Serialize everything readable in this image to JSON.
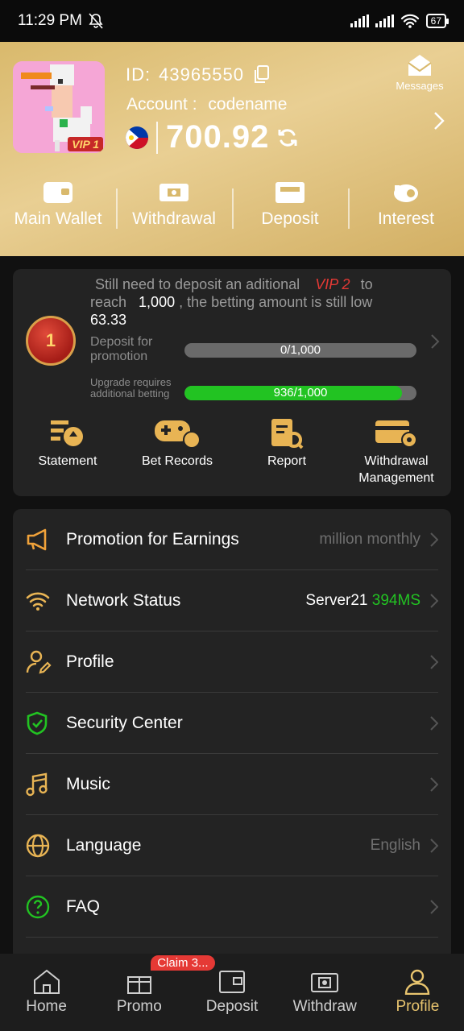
{
  "status_bar": {
    "time": "11:29 PM",
    "battery": "67"
  },
  "header": {
    "id_label": "ID:",
    "id_value": "43965550",
    "account_label": "Account :",
    "account_value": "codename",
    "vip_tag": "VIP 1",
    "balance": "700.92",
    "messages_label": "Messages",
    "wallet_items": [
      {
        "label": "Main Wallet",
        "icon": "wallet-icon"
      },
      {
        "label": "Withdrawal",
        "icon": "withdrawal-icon"
      },
      {
        "label": "Deposit",
        "icon": "deposit-icon"
      },
      {
        "label": "Interest",
        "icon": "piggy-bank-icon"
      }
    ]
  },
  "vip": {
    "line1_a": "Still need to deposit an aditional",
    "line1_vip": "VIP 2",
    "line1_b": "to",
    "line2_a": "reach",
    "line2_amount": "1,000",
    "line2_b": ", the betting amount is still low",
    "line3": "63.33",
    "badge_level": "1",
    "deposit_label": "Deposit for promotion",
    "deposit_bar_text": "0/1,000",
    "deposit_progress": 0,
    "betting_label": "Upgrade requires additional betting",
    "betting_bar_text": "936/1,000",
    "betting_progress": 0.936,
    "quick_items": [
      {
        "label": "Statement",
        "icon": "statement-icon"
      },
      {
        "label": "Bet Records",
        "icon": "gamepad-icon"
      },
      {
        "label": "Report",
        "icon": "report-icon"
      },
      {
        "label": "Withdrawal Management",
        "icon": "card-settings-icon"
      }
    ]
  },
  "menu": [
    {
      "label": "Promotion for Earnings",
      "value": "million monthly",
      "icon": "megaphone-icon"
    },
    {
      "label": "Network Status",
      "value": "Server21",
      "value_ms": "394MS",
      "icon": "wifi-icon"
    },
    {
      "label": "Profile",
      "value": "",
      "icon": "user-edit-icon"
    },
    {
      "label": "Security Center",
      "value": "",
      "icon": "shield-check-icon"
    },
    {
      "label": "Music",
      "value": "",
      "icon": "music-icon"
    },
    {
      "label": "Language",
      "value": "English",
      "icon": "globe-icon"
    },
    {
      "label": "FAQ",
      "value": "",
      "icon": "question-icon"
    }
  ],
  "bottom_nav": {
    "claim_badge": "Claim 3...",
    "items": [
      {
        "label": "Home",
        "icon": "home-icon",
        "active": false
      },
      {
        "label": "Promo",
        "icon": "gift-icon",
        "active": false
      },
      {
        "label": "Deposit",
        "icon": "deposit-icon",
        "active": false
      },
      {
        "label": "Withdraw",
        "icon": "withdraw-icon",
        "active": false
      },
      {
        "label": "Profile",
        "icon": "profile-icon",
        "active": true
      }
    ]
  },
  "colors": {
    "gold": "#e8c46e",
    "green": "#22c322",
    "red": "#e53935",
    "card": "#232323"
  }
}
